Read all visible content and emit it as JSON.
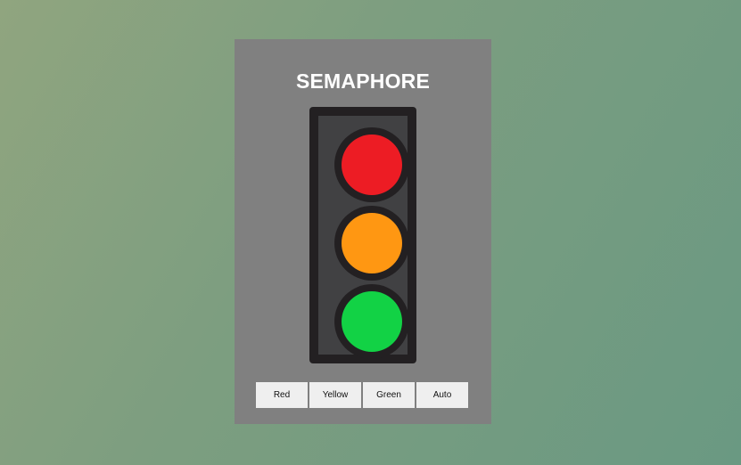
{
  "title": "SEMAPHORE",
  "lights": {
    "red": {
      "color": "#ed1c24"
    },
    "yellow": {
      "color": "#ff9712"
    },
    "green": {
      "color": "#12d245"
    }
  },
  "buttons": {
    "red_label": "Red",
    "yellow_label": "Yellow",
    "green_label": "Green",
    "auto_label": "Auto"
  }
}
